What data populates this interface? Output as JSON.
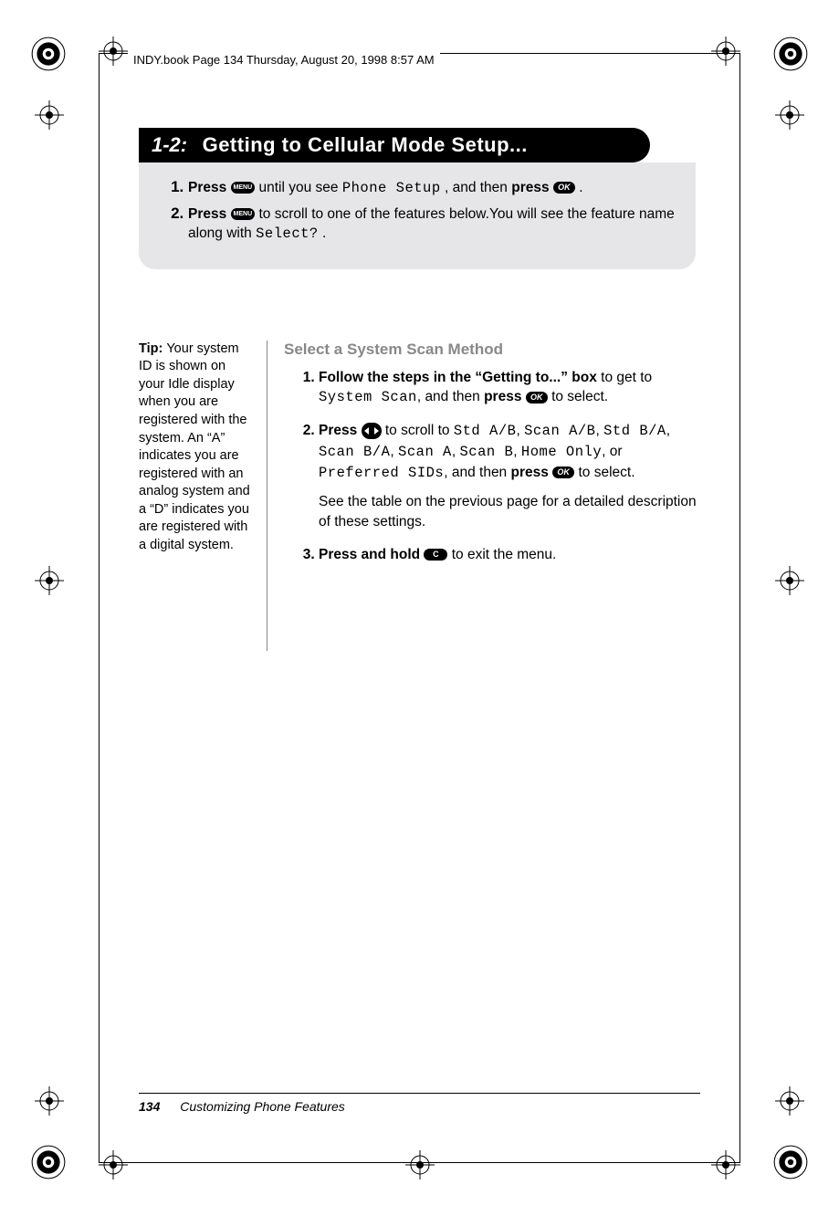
{
  "header": {
    "running": "INDY.book  Page 134  Thursday, August 20, 1998  8:57 AM"
  },
  "section": {
    "number": "1-2:",
    "title": "Getting to Cellular Mode Setup..."
  },
  "greybox": {
    "step1_a": "Press ",
    "step1_b": " until you see ",
    "step1_lcd": "Phone Setup",
    "step1_c": ", and then ",
    "step1_d": "press ",
    "step1_e": ".",
    "step2_a": "Press ",
    "step2_b": " to scroll to one of the features below.You will see the feature name along with ",
    "step2_lcd": "Select?",
    "step2_c": "."
  },
  "tip": {
    "label": "Tip: ",
    "body": "Your system ID is shown on your Idle display when you are registered with the system. An “A” indicates you are registered with an analog system and a “D” indicates you are registered with a digital system."
  },
  "main": {
    "heading": "Select a System Scan Method",
    "s1_a": "Follow the steps in the “Getting to...” box",
    "s1_b": " to get to ",
    "s1_lcd": "System Scan",
    "s1_c": ", and then ",
    "s1_d": "press ",
    "s1_e": " to select.",
    "s2_a": "Press ",
    "s2_b": " to scroll to ",
    "s2_opt1": "Std A/B",
    "s2_sep": ", ",
    "s2_opt2": "Scan A/B",
    "s2_sep2": ", ",
    "s2_opt3": "Std B/A",
    "s2_opt4": "Scan B/A",
    "s2_opt5": "Scan A",
    "s2_opt6": "Scan B",
    "s2_opt7": "Home Only",
    "s2_or": ", or ",
    "s2_opt8": "Preferred SIDs",
    "s2_c": ", and then ",
    "s2_d": "press ",
    "s2_e": " to select.",
    "s2_note": "See the table on the previous page for a detailed description of these settings.",
    "s3_a": "Press and hold ",
    "s3_b": " to exit the menu."
  },
  "footer": {
    "page": "134",
    "chapter": "Customizing Phone Features"
  },
  "icons": {
    "menu": "MENU",
    "ok": "OK",
    "c": "C"
  }
}
